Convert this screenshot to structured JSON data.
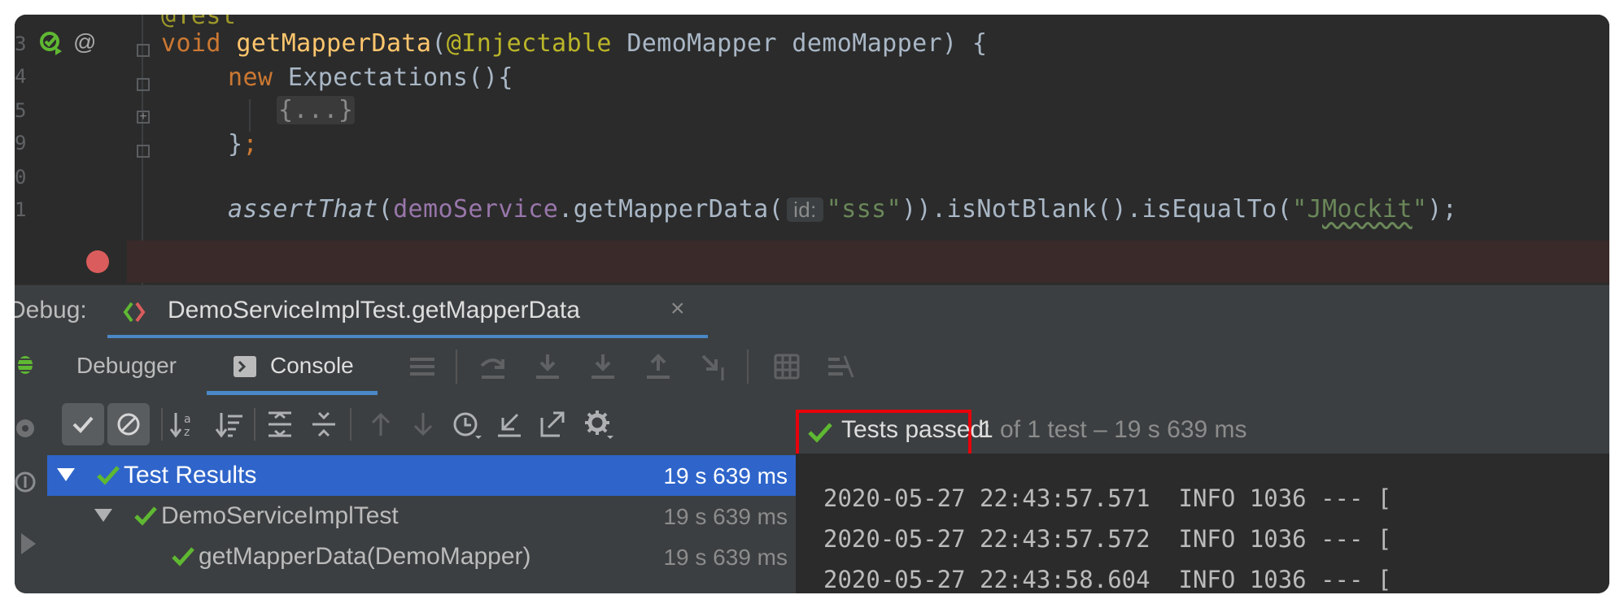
{
  "editor": {
    "annotation_partial": "@Test",
    "gutter_numbers": [
      "3",
      "4",
      "5",
      "9",
      "0",
      "1"
    ],
    "method_sig": {
      "kw": "void",
      "name": "getMapperData",
      "open": "(",
      "annotation": "@Injectable",
      "params": " DemoMapper demoMapper) {"
    },
    "line_new": {
      "kw": "new",
      "rest": " Expectations(){"
    },
    "folded": "{...}",
    "close_brace": "}",
    "close_semi": ";",
    "assert_line": {
      "method": "assertThat",
      "open": "(",
      "field": "demoService",
      "call": ".getMapperData(",
      "hint": "id:",
      "arg": "\"sss\"",
      "chain": ")).isNotBlank().isEqualTo(",
      "str_q1": "\"J",
      "str_wavy": "Mockit",
      "str_q2": "\"",
      "end": ");"
    }
  },
  "debug": {
    "label": "Debug:",
    "session_tab": "DemoServiceImplTest.getMapperData",
    "tabs": {
      "debugger": "Debugger",
      "console": "Console"
    }
  },
  "status": {
    "passed_label": "Tests passed:",
    "count": "1",
    "detail": " of 1 test – 19 s 639 ms"
  },
  "tree": {
    "rows": [
      {
        "label": "Test Results",
        "time": "19 s 639 ms"
      },
      {
        "label": "DemoServiceImplTest",
        "time": "19 s 639 ms"
      },
      {
        "label": "getMapperData(DemoMapper)",
        "time": "19 s 639 ms"
      }
    ]
  },
  "console": {
    "lines": [
      "2020-05-27 22:43:57.571  INFO 1036 --- [",
      "2020-05-27 22:43:57.572  INFO 1036 --- [",
      "2020-05-27 22:43:58.604  INFO 1036 --- ["
    ]
  },
  "colors": {
    "pass_green": "#5fb832",
    "selection": "#2f65ca",
    "highlight_box": "#e8000b",
    "breakpoint": "#db5c5c"
  }
}
